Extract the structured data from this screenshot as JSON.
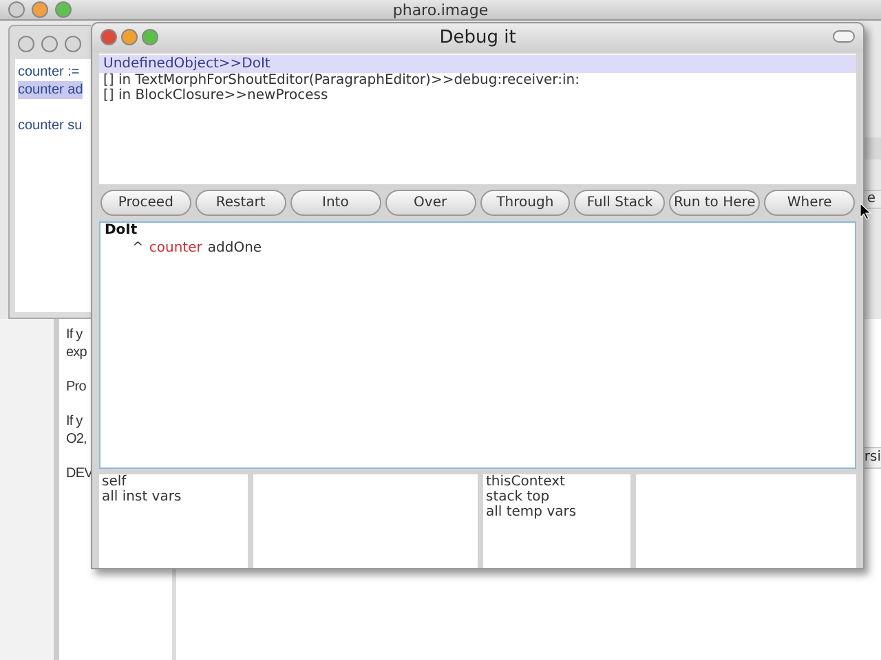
{
  "desktop_window": {
    "title": "pharo.image"
  },
  "workspace": {
    "lines": [
      {
        "text": "counter :=",
        "selected": false
      },
      {
        "text": "counter ad",
        "selected": true
      },
      {
        "text": "counter su",
        "selected": false
      }
    ]
  },
  "background_text": {
    "paragraphs": [
      [
        "If y",
        "exp"
      ],
      [
        "Pro"
      ],
      [
        "If y",
        "O2,"
      ],
      [
        "DEV"
      ]
    ]
  },
  "right_fragments": [
    "e",
    "rsi"
  ],
  "debugger": {
    "title": "Debug it",
    "stack": [
      {
        "text": "UndefinedObject>>DoIt",
        "selected": true
      },
      {
        "text": "[] in TextMorphForShoutEditor(ParagraphEditor)>>debug:receiver:in:",
        "selected": false
      },
      {
        "text": "[] in BlockClosure>>newProcess",
        "selected": false
      }
    ],
    "buttons": [
      "Proceed",
      "Restart",
      "Into",
      "Over",
      "Through",
      "Full Stack",
      "Run to Here",
      "Where"
    ],
    "code": {
      "method": "DoIt",
      "tokens": [
        {
          "text": "^",
          "kind": "plain"
        },
        {
          "text": "counter",
          "kind": "variable"
        },
        {
          "text": "addOne",
          "kind": "plain"
        }
      ]
    },
    "receiver_inspector": {
      "items": [
        "self",
        "all inst vars"
      ]
    },
    "context_inspector": {
      "items": [
        "thisContext",
        "stack top",
        "all temp vars"
      ]
    }
  }
}
